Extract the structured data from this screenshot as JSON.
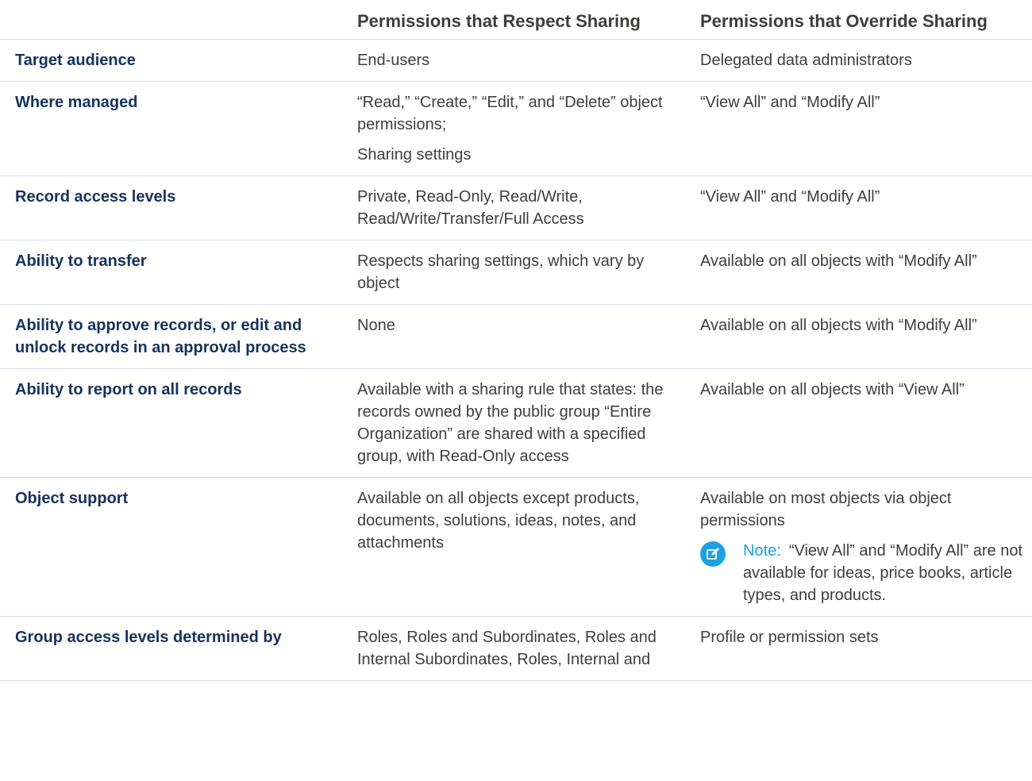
{
  "header": {
    "col1": "",
    "col2": "Permissions that Respect Sharing",
    "col3": "Permissions that Override Sharing"
  },
  "rows": [
    {
      "label": "Target audience",
      "respect": [
        "End-users"
      ],
      "override": [
        "Delegated data administrators"
      ]
    },
    {
      "label": "Where managed",
      "respect": [
        "“Read,” “Create,” “Edit,” and “Delete” object permissions;",
        "Sharing settings"
      ],
      "override": [
        "“View All” and “Modify All”"
      ]
    },
    {
      "label": "Record access levels",
      "respect": [
        "Private, Read-Only, Read/Write, Read/Write/Transfer/Full Access"
      ],
      "override": [
        "“View All” and “Modify All”"
      ]
    },
    {
      "label": "Ability to transfer",
      "respect": [
        "Respects sharing settings, which vary by object"
      ],
      "override": [
        "Available on all objects with “Modify All”"
      ]
    },
    {
      "label": "Ability to approve records, or edit and unlock records in an approval process",
      "respect": [
        "None"
      ],
      "override": [
        "Available on all objects with “Modify All”"
      ]
    },
    {
      "label": "Ability to report on all records",
      "respect": [
        "Available with a sharing rule that states: the records owned by the public group “Entire Organization” are shared with a specified group, with Read-Only access"
      ],
      "override": [
        "Available on all objects with “View All”"
      ]
    },
    {
      "label": "Object support",
      "respect": [
        "Available on all objects except products, documents, solutions, ideas, notes, and attachments"
      ],
      "override": [
        "Available on most objects via object permissions"
      ],
      "note": {
        "label": "Note:",
        "text": "“View All” and “Modify All” are not available for ideas, price books, article types, and products.",
        "icon": "edit-note-icon",
        "color": "#1ba1e2"
      }
    },
    {
      "label": "Group access levels determined by",
      "respect": [
        "Roles, Roles and Subordinates, Roles and Internal Subordinates, Roles, Internal and"
      ],
      "override": [
        "Profile or permission sets"
      ]
    }
  ],
  "colors": {
    "text": "#3e3e3c",
    "rowhead": "#16325c",
    "border": "#d8dde6",
    "accent": "#1ba1e2"
  }
}
